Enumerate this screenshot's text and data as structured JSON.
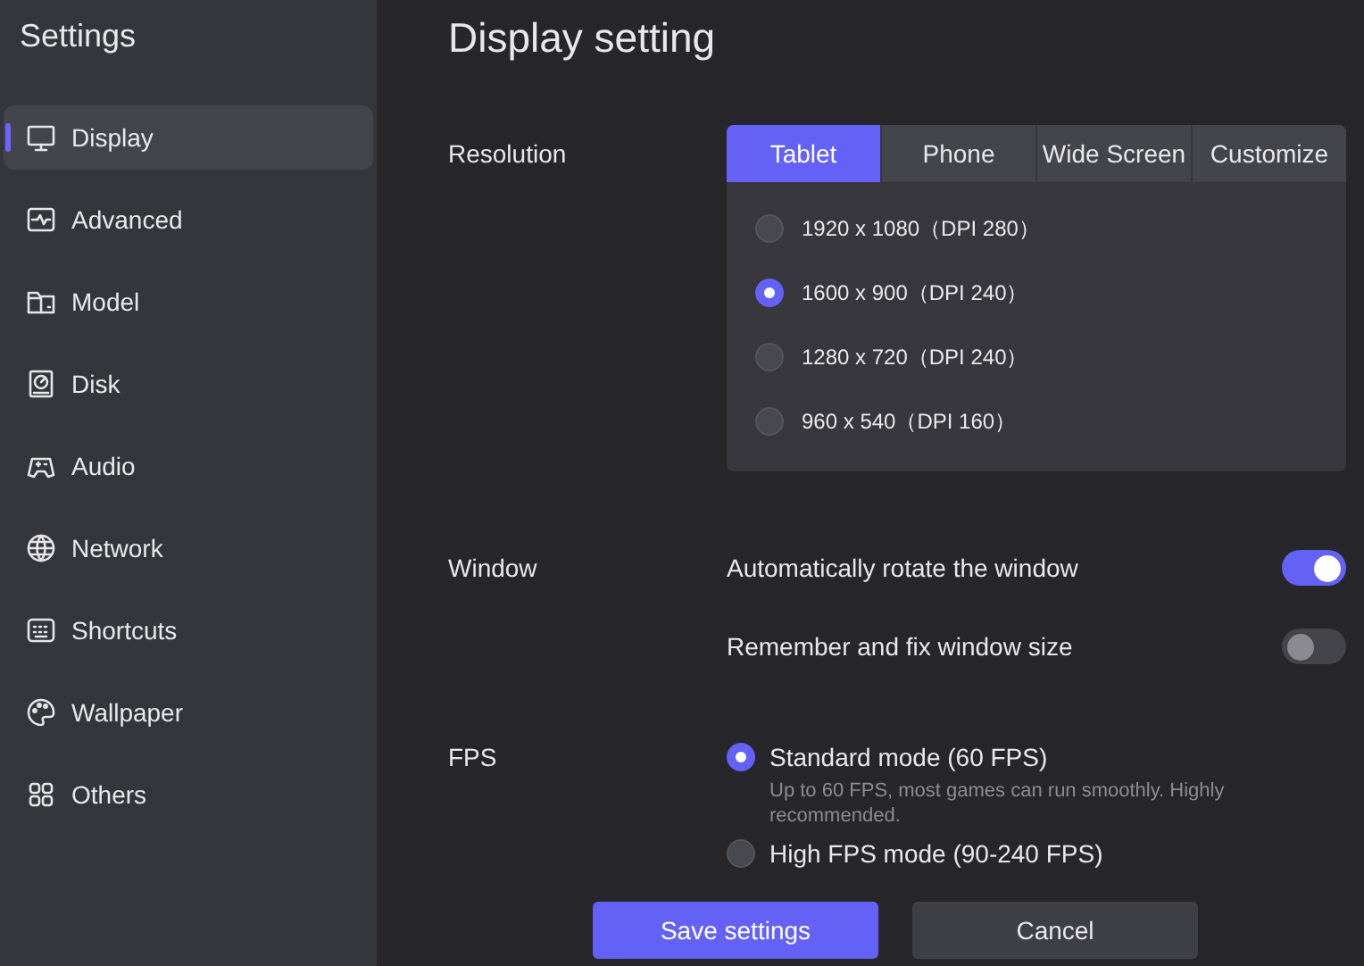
{
  "sidebar": {
    "title": "Settings",
    "items": [
      {
        "label": "Display",
        "selected": true
      },
      {
        "label": "Advanced",
        "selected": false
      },
      {
        "label": "Model",
        "selected": false
      },
      {
        "label": "Disk",
        "selected": false
      },
      {
        "label": "Audio",
        "selected": false
      },
      {
        "label": "Network",
        "selected": false
      },
      {
        "label": "Shortcuts",
        "selected": false
      },
      {
        "label": "Wallpaper",
        "selected": false
      },
      {
        "label": "Others",
        "selected": false
      }
    ]
  },
  "page_title": "Display setting",
  "resolution": {
    "label": "Resolution",
    "tabs": [
      {
        "label": "Tablet",
        "selected": true
      },
      {
        "label": "Phone",
        "selected": false
      },
      {
        "label": "Wide Screen",
        "selected": false
      },
      {
        "label": "Customize",
        "selected": false
      }
    ],
    "options": [
      {
        "label": "1920 x 1080（DPI 280）",
        "selected": false
      },
      {
        "label": "1600 x 900（DPI 240）",
        "selected": true
      },
      {
        "label": "1280 x 720（DPI 240）",
        "selected": false
      },
      {
        "label": "960 x 540（DPI 160）",
        "selected": false
      }
    ]
  },
  "window": {
    "label": "Window",
    "toggles": [
      {
        "label": "Automatically rotate the window",
        "on": true
      },
      {
        "label": "Remember and fix window size",
        "on": false
      }
    ]
  },
  "fps": {
    "label": "FPS",
    "modes": [
      {
        "label": "Standard mode (60 FPS)",
        "description": "Up to 60 FPS, most games can run smoothly. Highly recommended.",
        "selected": true
      },
      {
        "label": "High FPS mode (90-240 FPS)",
        "selected": false
      }
    ]
  },
  "buttons": [
    {
      "label": "Save settings",
      "kind": "primary"
    },
    {
      "label": "Cancel",
      "kind": "secondary"
    }
  ]
}
